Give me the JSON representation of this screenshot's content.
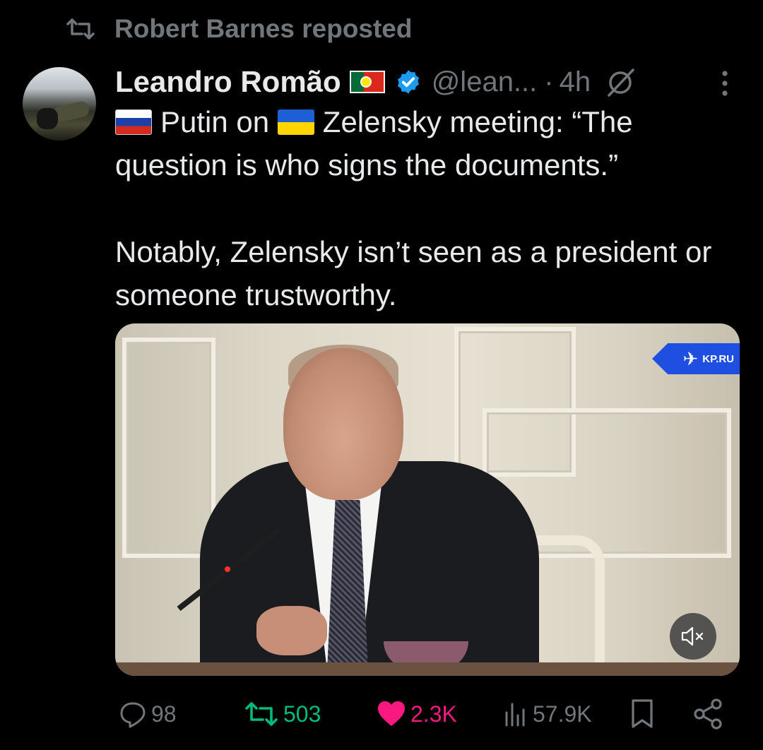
{
  "repost": {
    "label": "Robert Barnes reposted"
  },
  "tweet": {
    "author_name": "Leandro Romão",
    "handle": "@lean...",
    "separator": "·",
    "time": "4h",
    "text": {
      "part1": "Putin on",
      "part2": "Zelensky meeting: “The question is who signs the documents.”",
      "paragraph2": "Notably, Zelensky isn’t seen as a president or someone trustworthy."
    },
    "media": {
      "watermark": "KP.RU"
    },
    "stats": {
      "replies": "98",
      "reposts": "503",
      "likes": "2.3K",
      "views": "57.9K"
    }
  },
  "colors": {
    "background": "#000000",
    "text": "#e7e9ea",
    "muted": "#71767b",
    "verified": "#1d9bf0",
    "repost": "#00ba7c",
    "like": "#f91880"
  },
  "icons": [
    "repost-icon",
    "verified-badge-icon",
    "grok-icon",
    "more-icon",
    "mute-icon",
    "reply-icon",
    "heart-icon",
    "views-icon",
    "bookmark-icon",
    "share-icon"
  ]
}
